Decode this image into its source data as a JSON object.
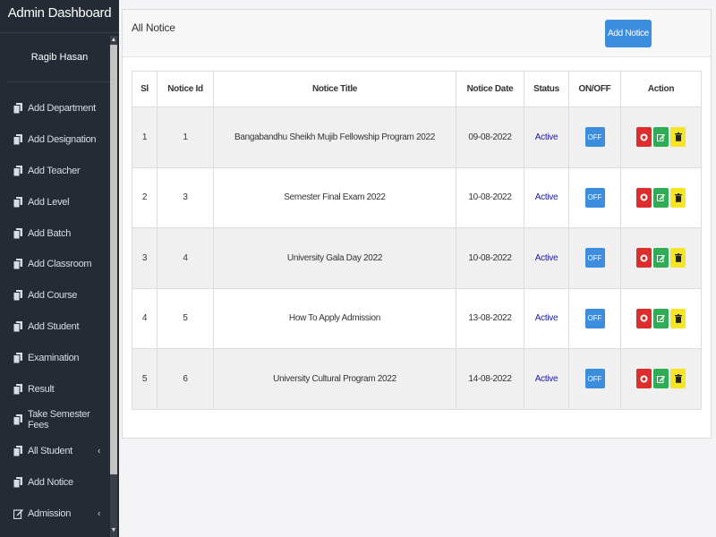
{
  "sidebar": {
    "brand": "Admin Dashboard",
    "user": "Ragib Hasan",
    "items": [
      {
        "label": "Add Department",
        "icon": "copy-icon"
      },
      {
        "label": "Add Designation",
        "icon": "copy-icon"
      },
      {
        "label": "Add Teacher",
        "icon": "copy-icon"
      },
      {
        "label": "Add Level",
        "icon": "copy-icon"
      },
      {
        "label": "Add Batch",
        "icon": "copy-icon"
      },
      {
        "label": "Add Classroom",
        "icon": "copy-icon"
      },
      {
        "label": "Add Course",
        "icon": "copy-icon"
      },
      {
        "label": "Add Student",
        "icon": "copy-icon"
      },
      {
        "label": "Examination",
        "icon": "copy-icon"
      },
      {
        "label": "Result",
        "icon": "copy-icon"
      },
      {
        "label": "Take Semester Fees",
        "icon": "copy-icon"
      },
      {
        "label": "All Student",
        "icon": "copy-icon",
        "chevron": "‹"
      },
      {
        "label": "Add Notice",
        "icon": "copy-icon"
      },
      {
        "label": "Admission",
        "icon": "edit-icon",
        "chevron": "‹"
      }
    ]
  },
  "card": {
    "title": "All Notice",
    "add_button": "Add Notice"
  },
  "table": {
    "headers": [
      "Sl",
      "Notice Id",
      "Notice Title",
      "Notice Date",
      "Status",
      "ON/OFF",
      "Action"
    ],
    "rows": [
      {
        "sl": "1",
        "id": "1",
        "title": "Bangabandhu Sheikh Mujib Fellowship Program 2022",
        "date": "09-08-2022",
        "status": "Active",
        "toggle": "OFF"
      },
      {
        "sl": "2",
        "id": "3",
        "title": "Semester Final Exam 2022",
        "date": "10-08-2022",
        "status": "Active",
        "toggle": "OFF"
      },
      {
        "sl": "3",
        "id": "4",
        "title": "University Gala Day 2022",
        "date": "10-08-2022",
        "status": "Active",
        "toggle": "OFF"
      },
      {
        "sl": "4",
        "id": "5",
        "title": "How To Apply Admission",
        "date": "13-08-2022",
        "status": "Active",
        "toggle": "OFF"
      },
      {
        "sl": "5",
        "id": "6",
        "title": "University Cultural Program 2022",
        "date": "14-08-2022",
        "status": "Active",
        "toggle": "OFF"
      }
    ]
  },
  "colors": {
    "sidebar_bg": "#252b34",
    "primary": "#3c8dde",
    "view": "#dd2d2d",
    "edit": "#2fac55",
    "delete": "#f5e524",
    "status_text": "#1a1aa8"
  }
}
